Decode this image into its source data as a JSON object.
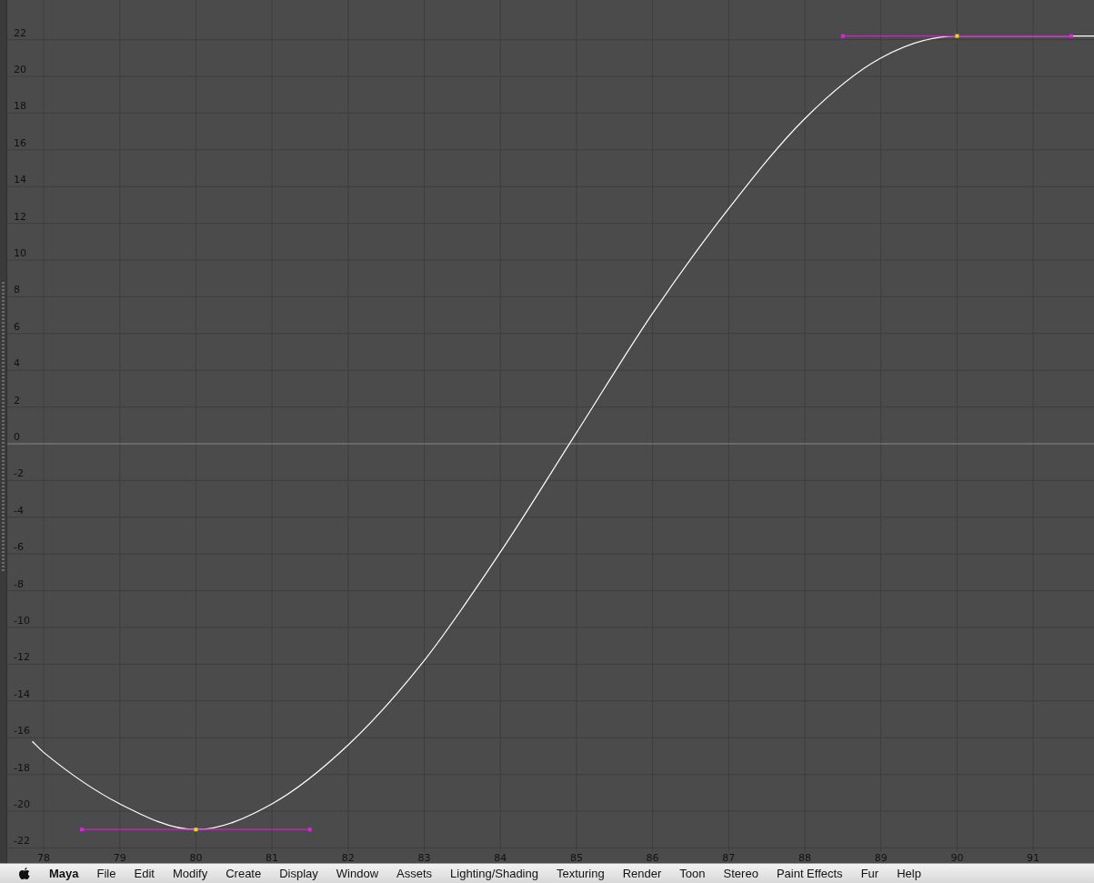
{
  "graph_editor": {
    "chart_data": {
      "type": "line",
      "x": [
        77.85,
        78,
        79,
        80,
        81,
        82,
        83,
        84,
        85,
        86,
        87,
        88,
        89,
        90,
        91,
        91.8
      ],
      "series": [
        {
          "color": "#ffffff",
          "values": [
            -16.2,
            -16.8,
            -19.6,
            -21,
            -19.6,
            -16.4,
            -11.8,
            -5.9,
            0.6,
            7.1,
            12.8,
            17.7,
            21,
            22.2,
            null,
            22.2
          ]
        }
      ],
      "xlim": [
        77.5,
        91.8
      ],
      "ylim": [
        -22.9,
        24.1
      ],
      "xticks": [
        78,
        79,
        80,
        81,
        82,
        83,
        84,
        85,
        86,
        87,
        88,
        89,
        90,
        91
      ],
      "yticks": [
        -22,
        -20,
        -18,
        -16,
        -14,
        -12,
        -10,
        -8,
        -6,
        -4,
        -2,
        0,
        2,
        4,
        6,
        8,
        10,
        12,
        14,
        16,
        18,
        20,
        22
      ],
      "grid": true
    }
  },
  "menu_bar": {
    "items": [
      "Maya",
      "File",
      "Edit",
      "Modify",
      "Create",
      "Display",
      "Window",
      "Assets",
      "Lighting/Shading",
      "Texturing",
      "Render",
      "Toon",
      "Stereo",
      "Paint Effects",
      "Fur",
      "Help"
    ]
  }
}
